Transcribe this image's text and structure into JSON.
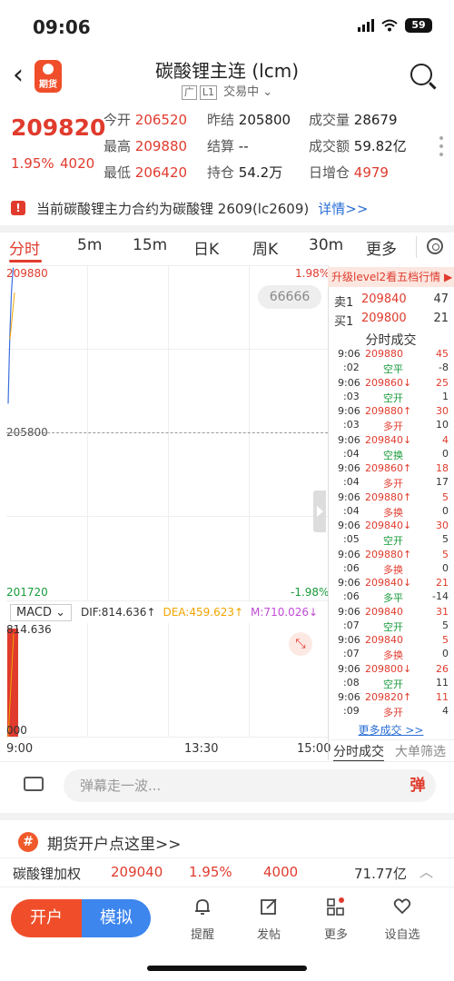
{
  "status": {
    "time": "09:06",
    "battery": "59"
  },
  "header": {
    "title": "碳酸锂主连 (lcm)",
    "logo_text": "期货",
    "tags": [
      "广",
      "L1"
    ],
    "trade_state": "交易中"
  },
  "quote": {
    "price": "209820",
    "change_pct": "1.95%",
    "change": "4020",
    "open_label": "今开",
    "open": "206520",
    "prev_settle_label": "昨结",
    "prev_settle": "205800",
    "volume_label": "成交量",
    "volume": "28679",
    "high_label": "最高",
    "high": "209880",
    "settle_label": "结算",
    "settle": "--",
    "turnover_label": "成交额",
    "turnover": "59.82亿",
    "low_label": "最低",
    "low": "206420",
    "oi_label": "持仓",
    "oi": "54.2万",
    "oi_change_label": "日增仓",
    "oi_change": "4979"
  },
  "notice": {
    "text": "当前碳酸锂主力合约为碳酸锂 2609(lc2609)",
    "link": "详情>>"
  },
  "tabs": [
    "分时",
    "5m",
    "15m",
    "日K",
    "周K",
    "30m",
    "更多"
  ],
  "chart": {
    "top_price": "209880",
    "top_pct": "1.98%",
    "mid_price": "205800",
    "bottom_price": "201720",
    "bottom_pct": "-1.98%",
    "bubble": "66666",
    "macd_label": "MACD",
    "dif": "DIF:814.636↑",
    "dea": "DEA:459.623↑",
    "m": "M:710.026↓",
    "macd_top": "814.636",
    "macd_bottom": "000",
    "time_start": "9:00",
    "time_mid": "13:30",
    "time_end": "15:00"
  },
  "chart_data": {
    "type": "line",
    "series": [
      {
        "name": "price",
        "x": [
          "9:00",
          "9:01",
          "9:02",
          "9:03",
          "9:04",
          "9:05",
          "9:06"
        ],
        "values": [
          206520,
          207400,
          208200,
          208800,
          209300,
          209600,
          209820
        ]
      }
    ],
    "ylim": [
      201720,
      209880
    ]
  },
  "panel": {
    "l2_banner": "升级level2看五档行情 ▶",
    "sell1_label": "卖1",
    "sell1_price": "209840",
    "sell1_vol": "47",
    "buy1_label": "买1",
    "buy1_price": "209800",
    "buy1_vol": "21",
    "trades_title": "分时成交",
    "trades": [
      {
        "time": "9:06",
        "sec": ":02",
        "price": "209880",
        "dir": "",
        "vol": "45",
        "kind": "空平",
        "delta": "-8",
        "pc": "red",
        "kc": "green",
        "dc": "gray"
      },
      {
        "time": "9:06",
        "sec": ":03",
        "price": "209860",
        "dir": "↓",
        "vol": "25",
        "kind": "空开",
        "delta": "1",
        "pc": "red",
        "kc": "green",
        "dc": "gray"
      },
      {
        "time": "9:06",
        "sec": ":03",
        "price": "209880",
        "dir": "↑",
        "vol": "30",
        "kind": "多开",
        "delta": "10",
        "pc": "red",
        "kc": "red",
        "dc": "gray"
      },
      {
        "time": "9:06",
        "sec": ":04",
        "price": "209840",
        "dir": "↓",
        "vol": "4",
        "kind": "空换",
        "delta": "0",
        "pc": "red",
        "kc": "green",
        "dc": "gray"
      },
      {
        "time": "9:06",
        "sec": ":04",
        "price": "209860",
        "dir": "↑",
        "vol": "18",
        "kind": "多开",
        "delta": "17",
        "pc": "red",
        "kc": "red",
        "dc": "gray"
      },
      {
        "time": "9:06",
        "sec": ":04",
        "price": "209880",
        "dir": "↑",
        "vol": "5",
        "kind": "多换",
        "delta": "0",
        "pc": "red",
        "kc": "red",
        "dc": "gray"
      },
      {
        "time": "9:06",
        "sec": ":05",
        "price": "209840",
        "dir": "↓",
        "vol": "30",
        "kind": "空开",
        "delta": "5",
        "pc": "red",
        "kc": "green",
        "dc": "gray"
      },
      {
        "time": "9:06",
        "sec": ":06",
        "price": "209880",
        "dir": "↑",
        "vol": "5",
        "kind": "多换",
        "delta": "0",
        "pc": "red",
        "kc": "red",
        "dc": "gray"
      },
      {
        "time": "9:06",
        "sec": ":06",
        "price": "209840",
        "dir": "↓",
        "vol": "21",
        "kind": "多平",
        "delta": "-14",
        "pc": "red",
        "kc": "green",
        "dc": "gray"
      },
      {
        "time": "9:06",
        "sec": ":07",
        "price": "209840",
        "dir": "",
        "vol": "31",
        "kind": "空开",
        "delta": "5",
        "pc": "red",
        "kc": "green",
        "dc": "gray"
      },
      {
        "time": "9:06",
        "sec": ":07",
        "price": "209840",
        "dir": "",
        "vol": "5",
        "kind": "多换",
        "delta": "0",
        "pc": "red",
        "kc": "red",
        "dc": "gray"
      },
      {
        "time": "9:06",
        "sec": ":08",
        "price": "209800",
        "dir": "↓",
        "vol": "26",
        "kind": "空开",
        "delta": "11",
        "pc": "red",
        "kc": "green",
        "dc": "gray"
      },
      {
        "time": "9:06",
        "sec": ":09",
        "price": "209820",
        "dir": "↑",
        "vol": "11",
        "kind": "多开",
        "delta": "4",
        "pc": "red",
        "kc": "red",
        "dc": "gray"
      }
    ],
    "more": "更多成交 >>",
    "tab_trades": "分时成交",
    "tab_filter": "大单筛选"
  },
  "danmaku": {
    "placeholder": "弹幕走一波...",
    "send": "弹"
  },
  "promo": {
    "icon": "#",
    "text": "期货开户点这里>>"
  },
  "option_row": {
    "name": "碳酸锂加权",
    "price": "209040",
    "pct": "1.95%",
    "change": "4000",
    "amount": "71.77亿"
  },
  "bottom": {
    "open_account": "开户",
    "simulate": "模拟",
    "nav": [
      "提醒",
      "发帖",
      "更多",
      "设自选"
    ]
  },
  "colors": {
    "up": "#e03b2d",
    "down": "#1a9b3c",
    "link": "#2b6fd6",
    "accent": "#f04e2a",
    "sim": "#3d86ee"
  }
}
